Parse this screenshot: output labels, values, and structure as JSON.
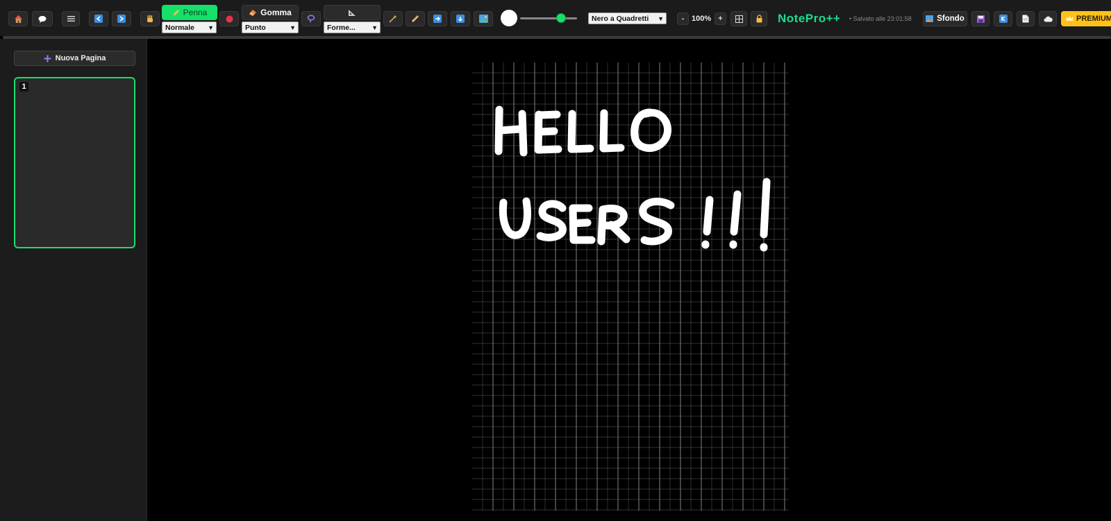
{
  "app": {
    "brand": "NotePro++",
    "saved_status": "• Salvato alle 23:01:58"
  },
  "toolbar": {
    "pen": {
      "label": "Penna",
      "mode": "Normale"
    },
    "eraser": {
      "label": "Gomma",
      "mode": "Punto"
    },
    "shapes": {
      "mode": "Forme..."
    },
    "brush": {
      "size_fraction": 0.72,
      "color": "#ffffff"
    },
    "background_select": "Nero a Quadretti",
    "zoom": {
      "minus": "-",
      "value": "100%",
      "plus": "+"
    },
    "sfondo_label": "Sfondo",
    "premium_label": "PREMIUM",
    "icons": [
      "home-icon",
      "chat-icon",
      "menu-icon",
      "undo-icon",
      "redo-icon",
      "hand-icon",
      "color-dot-icon",
      "lasso-icon",
      "ruler-triangle-icon",
      "magic-wand-icon",
      "ruler-icon",
      "arrow-right-icon",
      "arrow-down-icon",
      "image-icon",
      "grid-icon",
      "lock-icon",
      "save-icon",
      "share-icon",
      "document-icon",
      "cloud-icon",
      "crown-icon"
    ]
  },
  "sidebar": {
    "new_page_label": "Nuova Pagina",
    "pages": [
      {
        "number": "1"
      }
    ]
  },
  "colors": {
    "accent_green": "#14e06a",
    "brand_teal": "#19dd8f",
    "premium": "#ffc21a",
    "ink": "#ffffff",
    "paper_bg": "#000000",
    "grid_line": "#7a7a7a"
  },
  "canvas": {
    "handwritten_text": [
      "HELLO",
      "USERS!!!"
    ]
  }
}
